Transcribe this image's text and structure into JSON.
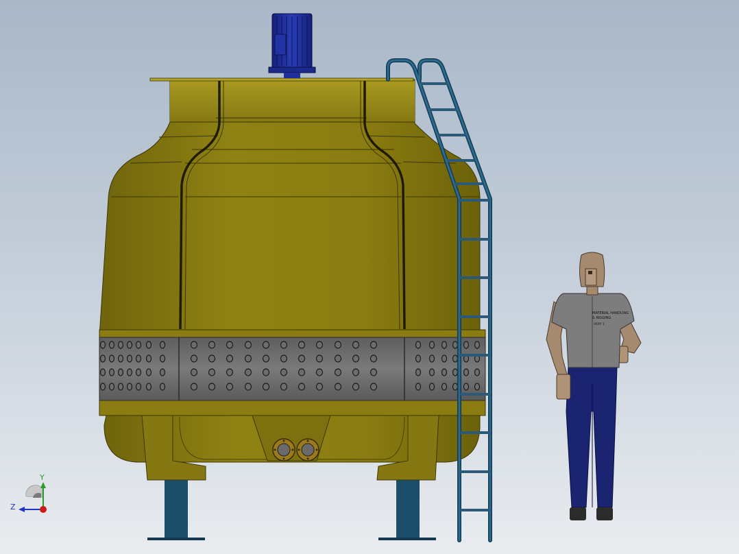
{
  "triad": {
    "y_label": "Y",
    "z_label": "Z"
  },
  "shirt_text": [
    "MATERIAL HANDLING",
    "& RIGGING",
    "VERY 1"
  ],
  "colors": {
    "tower_body": "#8a7c10",
    "tower_body_light": "#a89920",
    "tower_dark": "#5c520a",
    "louver_band": "#6f6f6f",
    "motor": "#1e2f9a",
    "ladder": "#2a5a78",
    "legs": "#1d4e69",
    "flange": "#9a7a1a",
    "shirt": "#7d7d7d",
    "pants": "#1a2470",
    "skin": "#a68a70"
  },
  "icons": {
    "triad": "coordinate-axes-icon"
  }
}
